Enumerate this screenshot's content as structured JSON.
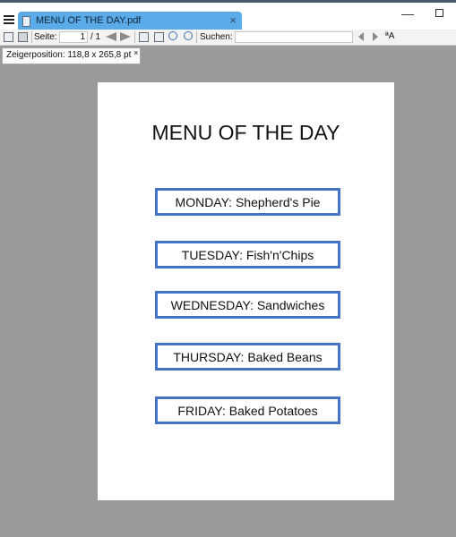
{
  "tab": {
    "title": "MENU OF THE DAY.pdf",
    "close": "×"
  },
  "window": {
    "minimize": "—"
  },
  "toolbar": {
    "page_label": "Seite:",
    "page_current": "1",
    "page_total": "/ 1",
    "search_label": "Suchen:",
    "search_value": "",
    "font_icon": "ªA"
  },
  "tooltip": {
    "text": "Zeigerposition: 118,8 x 265,8 pt",
    "close": "×"
  },
  "document": {
    "title": "MENU OF THE DAY",
    "days": [
      "MONDAY: Shepherd's Pie",
      "TUESDAY: Fish'n'Chips",
      "WEDNESDAY: Sandwiches",
      "THURSDAY: Baked Beans",
      "FRIDAY: Baked Potatoes"
    ]
  },
  "colors": {
    "accent_tab": "#5aabe8",
    "box_border": "#4472c4",
    "viewer_bg": "#9a9a9a"
  }
}
